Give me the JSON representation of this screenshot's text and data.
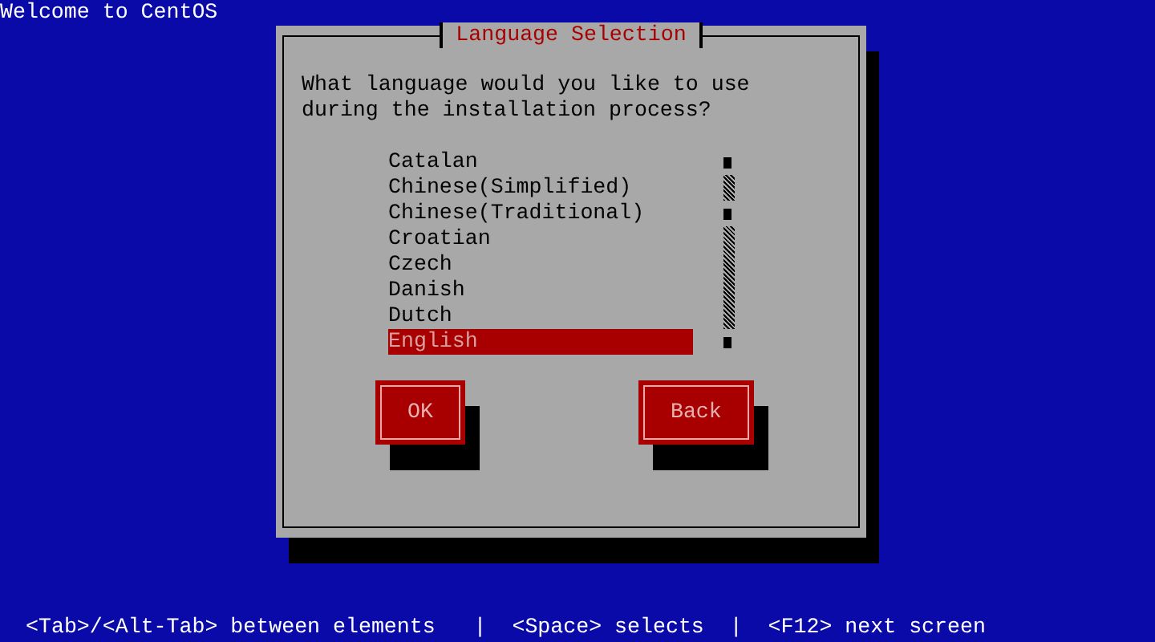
{
  "screen_title": "Welcome to CentOS",
  "dialog": {
    "title": "Language Selection",
    "prompt": "What language would you like to use during the installation process?",
    "languages": [
      {
        "label": "Catalan",
        "selected": false
      },
      {
        "label": "Chinese(Simplified)",
        "selected": false
      },
      {
        "label": "Chinese(Traditional)",
        "selected": false
      },
      {
        "label": "Croatian",
        "selected": false
      },
      {
        "label": "Czech",
        "selected": false
      },
      {
        "label": "Danish",
        "selected": false
      },
      {
        "label": "Dutch",
        "selected": false
      },
      {
        "label": "English",
        "selected": true
      }
    ],
    "buttons": [
      "OK",
      "Back"
    ]
  },
  "status_bar": "<Tab>/<Alt-Tab> between elements   |  <Space> selects  |  <F12> next screen"
}
